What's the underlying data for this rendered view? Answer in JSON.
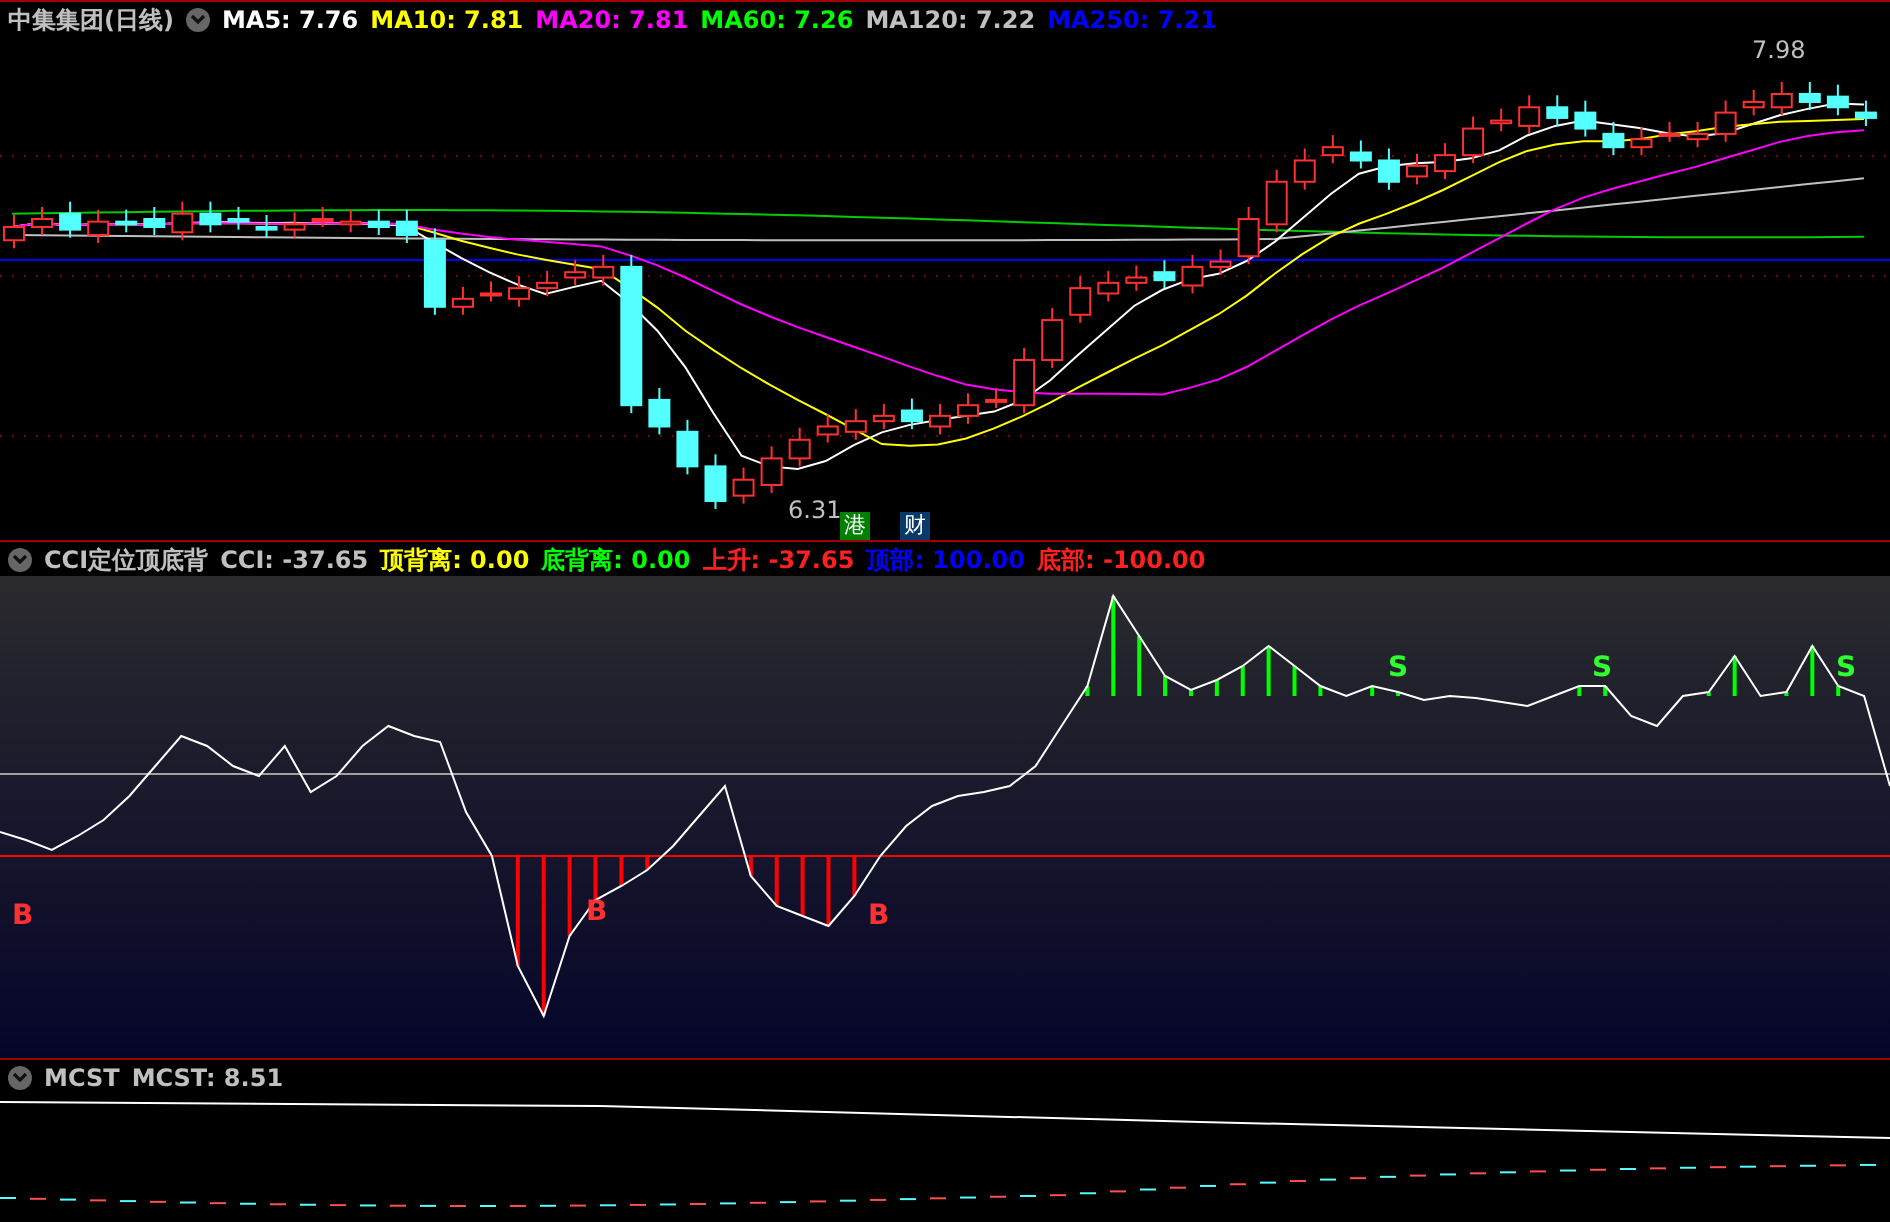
{
  "main_panel": {
    "title": "中集集团(日线)",
    "indicators": [
      {
        "label": "MA5: 7.76",
        "color": "#ffffff"
      },
      {
        "label": "MA10: 7.81",
        "color": "#ffff00"
      },
      {
        "label": "MA20: 7.81",
        "color": "#ff00ff"
      },
      {
        "label": "MA60: 7.26",
        "color": "#00ff00"
      },
      {
        "label": "MA120: 7.22",
        "color": "#c0c0c0"
      },
      {
        "label": "MA250: 7.21",
        "color": "#0000ff"
      }
    ],
    "high_label": "7.98",
    "low_label": "6.31",
    "badges": [
      {
        "text": "港",
        "color": "#008000"
      },
      {
        "text": "财",
        "color": "#0a3a6a"
      }
    ]
  },
  "cci_panel": {
    "title": "CCI定位顶底背",
    "indicators": [
      {
        "label": "CCI: -37.65",
        "color": "#c0c0c0"
      },
      {
        "label": "顶背离: 0.00",
        "color": "#ffff00"
      },
      {
        "label": "底背离: 0.00",
        "color": "#00ff00"
      },
      {
        "label": "上升: -37.65",
        "color": "#ff2020"
      },
      {
        "label": "顶部: 100.00",
        "color": "#0000ff"
      },
      {
        "label": "底部: -100.00",
        "color": "#ff2020"
      }
    ],
    "signals": [
      {
        "text": "B",
        "kind": "buy"
      },
      {
        "text": "B",
        "kind": "buy"
      },
      {
        "text": "B",
        "kind": "buy"
      },
      {
        "text": "S",
        "kind": "sell"
      },
      {
        "text": "S",
        "kind": "sell"
      },
      {
        "text": "S",
        "kind": "sell"
      }
    ]
  },
  "mcst_panel": {
    "title": "MCST",
    "indicators": [
      {
        "label": "MCST: 8.51",
        "color": "#c0c0c0"
      }
    ]
  }
}
